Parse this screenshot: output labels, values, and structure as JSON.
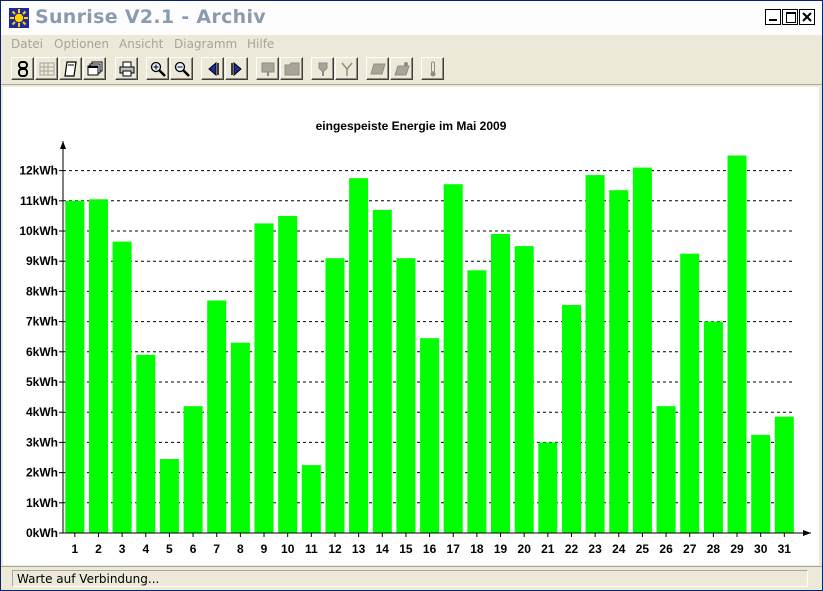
{
  "window": {
    "title": "Sunrise V2.1 - Archiv",
    "icon": "sun-icon"
  },
  "menu": {
    "items": [
      "Datei",
      "Optionen",
      "Ansicht",
      "Diagramm",
      "Hilfe"
    ]
  },
  "toolbar": {
    "buttons": [
      {
        "icon": "connect-icon",
        "enabled": true
      },
      {
        "icon": "grid-icon",
        "enabled": false
      },
      {
        "icon": "document-icon",
        "enabled": true
      },
      {
        "icon": "windows-icon",
        "enabled": true
      },
      {
        "icon": "print-icon",
        "enabled": true
      },
      {
        "icon": "zoom-in-icon",
        "enabled": true
      },
      {
        "icon": "zoom-out-icon",
        "enabled": true
      },
      {
        "icon": "arrow-left-icon",
        "enabled": true
      },
      {
        "icon": "arrow-right-icon",
        "enabled": true
      },
      {
        "icon": "note-icon",
        "enabled": false
      },
      {
        "icon": "folder-icon",
        "enabled": false
      },
      {
        "icon": "plug-icon",
        "enabled": false
      },
      {
        "icon": "antenna-icon",
        "enabled": false
      },
      {
        "icon": "panel-icon",
        "enabled": false
      },
      {
        "icon": "panel-sun-icon",
        "enabled": false
      },
      {
        "icon": "thermometer-icon",
        "enabled": false
      }
    ]
  },
  "chart_data": {
    "type": "bar",
    "title": "eingespeiste Energie im Mai 2009",
    "xlabel": "",
    "ylabel": "",
    "categories": [
      "1",
      "2",
      "3",
      "4",
      "5",
      "6",
      "7",
      "8",
      "9",
      "10",
      "11",
      "12",
      "13",
      "14",
      "15",
      "16",
      "17",
      "18",
      "19",
      "20",
      "21",
      "22",
      "23",
      "24",
      "25",
      "26",
      "27",
      "28",
      "29",
      "30",
      "31"
    ],
    "values": [
      11.0,
      11.05,
      9.65,
      5.9,
      2.45,
      4.2,
      7.7,
      6.3,
      10.25,
      10.5,
      2.25,
      9.1,
      11.75,
      10.7,
      9.1,
      6.45,
      11.55,
      8.7,
      9.9,
      9.5,
      3.0,
      7.55,
      11.85,
      11.35,
      12.1,
      4.2,
      9.25,
      7.0,
      12.5,
      3.25,
      3.85
    ],
    "ylim": [
      0,
      12.5
    ],
    "yticks": [
      "0kWh",
      "1kWh",
      "2kWh",
      "3kWh",
      "4kWh",
      "5kWh",
      "6kWh",
      "7kWh",
      "8kWh",
      "9kWh",
      "10kWh",
      "11kWh",
      "12kWh"
    ],
    "grid": true,
    "bar_color": "#00ff00",
    "grid_color": "#000000"
  },
  "status": {
    "text": "Warte auf Verbindung..."
  }
}
